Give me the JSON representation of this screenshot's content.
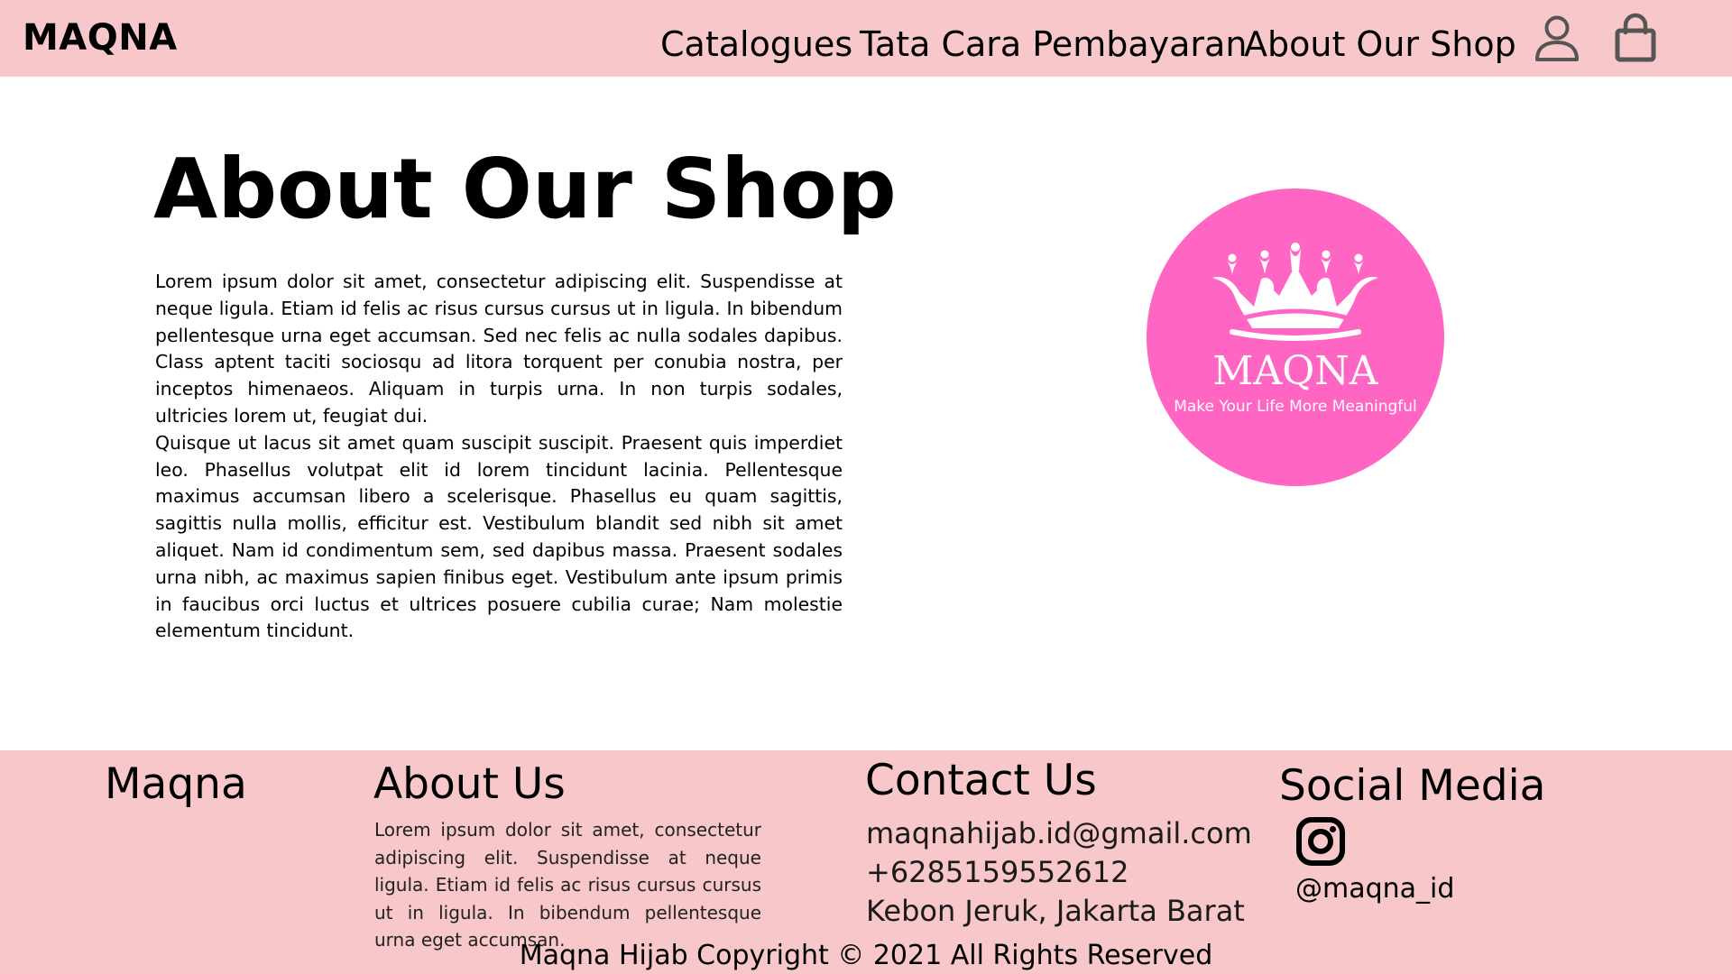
{
  "header": {
    "brand": "MAQNA",
    "nav": [
      {
        "label": "Catalogues"
      },
      {
        "label": "Tata Cara Pembayaran"
      },
      {
        "label": "About Our Shop"
      }
    ],
    "icons": {
      "account": "user-icon",
      "cart": "shopping-bag-icon"
    }
  },
  "main": {
    "title": "About Our Shop",
    "paragraphs": [
      "Lorem ipsum dolor sit amet, consectetur adipiscing elit. Suspendisse at neque ligula. Etiam id felis ac risus cursus cursus ut in ligula. In bibendum pellentesque urna eget accumsan. Sed nec felis ac nulla sodales dapibus. Class aptent taciti sociosqu ad litora torquent per conubia nostra, per inceptos himenaeos. Aliquam in turpis urna. In non turpis sodales, ultricies lorem ut, feugiat dui.",
      "Quisque ut lacus sit amet quam suscipit suscipit. Praesent quis imperdiet leo. Phasellus volutpat elit id lorem tincidunt lacinia. Pellentesque maximus accumsan libero a scelerisque. Phasellus eu quam sagittis, sagittis nulla mollis, efficitur est. Vestibulum blandit sed nibh sit amet aliquet. Nam id condimentum sem, sed dapibus massa. Praesent sodales urna nibh, ac maximus sapien finibus eget. Vestibulum ante ipsum primis in faucibus orci luctus et ultrices posuere cubilia curae; Nam molestie elementum tincidunt."
    ],
    "logo": {
      "name": "MAQNA",
      "tagline": "Make Your Life More Meaningful",
      "color": "#ff66c4"
    }
  },
  "footer": {
    "brand": "Maqna",
    "about": {
      "heading": "About Us",
      "text": "Lorem ipsum dolor sit amet, consectetur adipiscing elit. Suspendisse at neque ligula. Etiam id felis ac risus cursus cursus ut in ligula. In bibendum pellentesque urna eget accumsan."
    },
    "contact": {
      "heading": "Contact Us",
      "email": "maqnahijab.id@gmail.com",
      "phone": "+6285159552612",
      "address": "Kebon Jeruk, Jakarta Barat"
    },
    "social": {
      "heading": "Social Media",
      "instagram_handle": "@maqna_id",
      "icon": "instagram-icon"
    },
    "copyright": "Maqna Hijab Copyright © 2021 All Rights Reserved"
  },
  "colors": {
    "header_bg": "#f7c7c9",
    "footer_bg": "#f7c7c9",
    "logo_bg": "#ff66c4",
    "icon_gray": "#555555"
  }
}
